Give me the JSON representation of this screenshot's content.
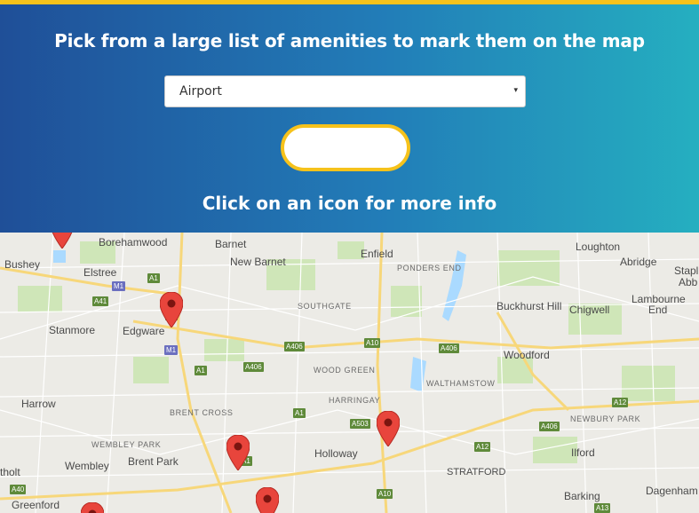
{
  "header": {
    "title": "Pick from a large list of amenities to mark them on the map",
    "selected_amenity": "Airport",
    "select_arrow": "▾",
    "instruction": "Click on an icon for more info"
  },
  "colors": {
    "accent": "#f6c21b",
    "header_start": "#1f4f98",
    "header_end": "#25afc0",
    "marker": "#e8453c"
  },
  "map": {
    "places": [
      "Borehamwood",
      "Barnet",
      "Enfield",
      "Loughton",
      "Bushey",
      "New Barnet",
      "Abridge",
      "Elstree",
      "Stapl",
      "Abb",
      "Lambourne",
      "End",
      "Chigwell",
      "Buckhurst Hill",
      "Stanmore",
      "Edgware",
      "Woodford",
      "Harrow",
      "Wembley",
      "Brent Park",
      "Holloway",
      "Ilford",
      "Dagenham",
      "Greenford",
      "Barking",
      "STRATFORD",
      "tholt"
    ],
    "districts": [
      "PONDERS END",
      "SOUTHGATE",
      "WOOD GREEN",
      "WALTHAMSTOW",
      "HARRINGAY",
      "BRENT CROSS",
      "NEWBURY PARK",
      "WEMBLEY PARK"
    ],
    "roads": [
      "A1",
      "M1",
      "A41",
      "A1",
      "M1",
      "A406",
      "A10",
      "A406",
      "A1",
      "A406",
      "A12",
      "A406",
      "A503",
      "A1",
      "A12",
      "A40",
      "A10",
      "A13",
      "A1"
    ],
    "marker_icon": "map-pin-icon"
  }
}
